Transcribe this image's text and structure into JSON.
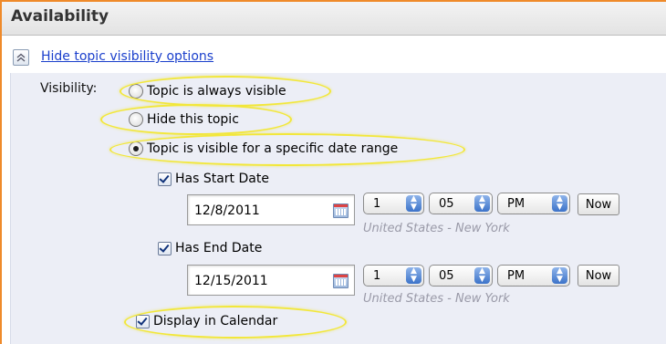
{
  "section": {
    "title": "Availability"
  },
  "toggle": {
    "label": "Hide topic visibility options"
  },
  "visibility": {
    "label": "Visibility:",
    "options": [
      {
        "label": "Topic is always visible",
        "checked": false
      },
      {
        "label": "Hide this topic",
        "checked": false
      },
      {
        "label": "Topic is visible for a specific date range",
        "checked": true
      }
    ]
  },
  "start": {
    "checkbox_label": "Has Start Date",
    "checked": true,
    "date": "12/8/2011",
    "hour": "1",
    "minute": "05",
    "ampm": "PM",
    "now_label": "Now",
    "timezone": "United States - New York"
  },
  "end": {
    "checkbox_label": "Has End Date",
    "checked": true,
    "date": "12/15/2011",
    "hour": "1",
    "minute": "05",
    "ampm": "PM",
    "now_label": "Now",
    "timezone": "United States - New York"
  },
  "calendar": {
    "label": "Display in Calendar",
    "checked": true
  },
  "colors": {
    "accent_orange": "#ef8a2a",
    "highlight_yellow": "#f2e73a",
    "link_blue": "#1a3fcc",
    "panel_bg": "#eceef6"
  },
  "icons": {
    "toggle": "collapse-chevron-up-icon",
    "calendar": "calendar-icon",
    "spinner": "up-down-spinner-icon"
  }
}
